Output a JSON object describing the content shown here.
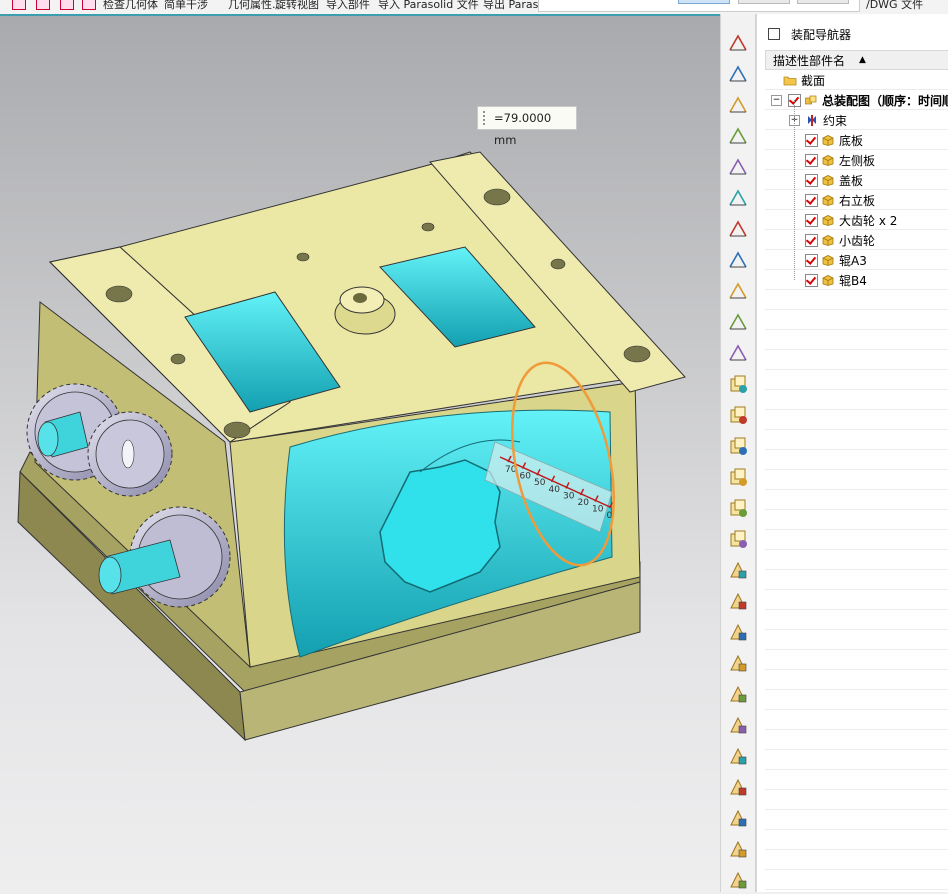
{
  "menu": {
    "items": [
      "检查几何体",
      "简单干涉",
      "几何属性...",
      "旋转视图",
      "导入部件",
      "导入 Parasolid 文件",
      "导出 Paraso"
    ],
    "trailing": "/DWG 文件"
  },
  "viewport": {
    "dimension_label": "=79.0000 mm",
    "ruler_ticks": [
      "70",
      "60",
      "50",
      "40",
      "30",
      "20",
      "10",
      "0"
    ]
  },
  "toolbar": {
    "icons": [
      "section-view-icon",
      "measure-distance-icon",
      "measure-angle-icon",
      "measure-length-icon",
      "measure-radius-icon",
      "arc-measure-icon",
      "curve-analysis-icon",
      "face-curvature-icon",
      "surface-analysis-icon",
      "face-slope-icon",
      "check-geometry-icon",
      "move-component-icon",
      "add-component-icon",
      "remove-component-icon",
      "replace-component-icon",
      "pattern-component-icon",
      "mirror-component-icon",
      "cylinder-feature-icon",
      "pyramid-feature-icon",
      "cone-feature-icon",
      "draft-feature-icon",
      "box-feature-icon",
      "chamfer-feature-icon",
      "boolean-feature-icon",
      "shell-feature-icon",
      "hole-feature-icon",
      "datum-plane-icon",
      "export-feature-icon"
    ]
  },
  "navigator": {
    "title": "装配导航器",
    "column_header": "描述性部件名",
    "rows": [
      {
        "label": "截面",
        "type": "folder"
      },
      {
        "label": "总装配图（顺序：时间顺",
        "type": "assembly"
      },
      {
        "label": "约束",
        "type": "constraints"
      },
      {
        "label": "底板",
        "type": "part"
      },
      {
        "label": "左侧板",
        "type": "part"
      },
      {
        "label": "盖板",
        "type": "part"
      },
      {
        "label": "右立板",
        "type": "part"
      },
      {
        "label": "大齿轮 x 2",
        "type": "part"
      },
      {
        "label": "小齿轮",
        "type": "part"
      },
      {
        "label": "辊A3",
        "type": "part"
      },
      {
        "label": "辊B4",
        "type": "part"
      }
    ]
  },
  "colors": {
    "body": "#e6e29a",
    "cavity": "#22d8e4",
    "gear": "#b9b7cf",
    "highlight_circle": "#f09a3a",
    "viewport_accent": "#3b9fb0"
  }
}
